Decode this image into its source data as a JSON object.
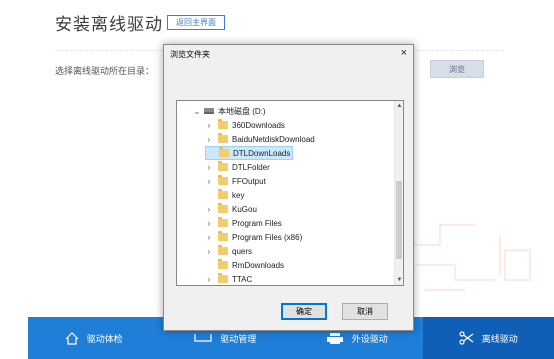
{
  "app": {
    "title": "安装离线驱动",
    "return_label": "返回主界面",
    "dir_label": "选择离线驱动所在目录：",
    "browse_label": "浏览"
  },
  "bottom_nav": [
    {
      "label": "驱动体检",
      "icon": "home-icon",
      "active": false
    },
    {
      "label": "驱动管理",
      "icon": "monitor-icon",
      "active": false
    },
    {
      "label": "外设驱动",
      "icon": "printer-icon",
      "active": false
    },
    {
      "label": "离线驱动",
      "icon": "scissors-tool-icon",
      "active": true
    }
  ],
  "dialog": {
    "title": "浏览文件夹",
    "close": "×",
    "ok_label": "确定",
    "cancel_label": "取消",
    "tree": [
      {
        "label": "本地磁盘 (D:)",
        "type": "drive",
        "arrow": "⌄",
        "level": 0
      },
      {
        "label": "360Downloads",
        "type": "folder",
        "arrow": "›",
        "level": 1
      },
      {
        "label": "BaiduNetdiskDownload",
        "type": "folder",
        "arrow": "›",
        "level": 1
      },
      {
        "label": "DTLDownLoads",
        "type": "folder",
        "arrow": "",
        "level": 1,
        "selected": true
      },
      {
        "label": "DTLFolder",
        "type": "folder",
        "arrow": "›",
        "level": 1
      },
      {
        "label": "FFOutput",
        "type": "folder",
        "arrow": "›",
        "level": 1
      },
      {
        "label": "key",
        "type": "folder",
        "arrow": "",
        "level": 1
      },
      {
        "label": "KuGou",
        "type": "folder",
        "arrow": "›",
        "level": 1
      },
      {
        "label": "Program Files",
        "type": "folder",
        "arrow": "›",
        "level": 1
      },
      {
        "label": "Program Files (x86)",
        "type": "folder",
        "arrow": "›",
        "level": 1
      },
      {
        "label": "quers",
        "type": "folder",
        "arrow": "›",
        "level": 1
      },
      {
        "label": "RmDownloads",
        "type": "folder",
        "arrow": "",
        "level": 1
      },
      {
        "label": "TTAC",
        "type": "folder",
        "arrow": "›",
        "level": 1
      }
    ]
  },
  "colors": {
    "accent": "#1f7ed8",
    "active_nav": "#0f5fb7",
    "selection": "#cce8ff"
  }
}
